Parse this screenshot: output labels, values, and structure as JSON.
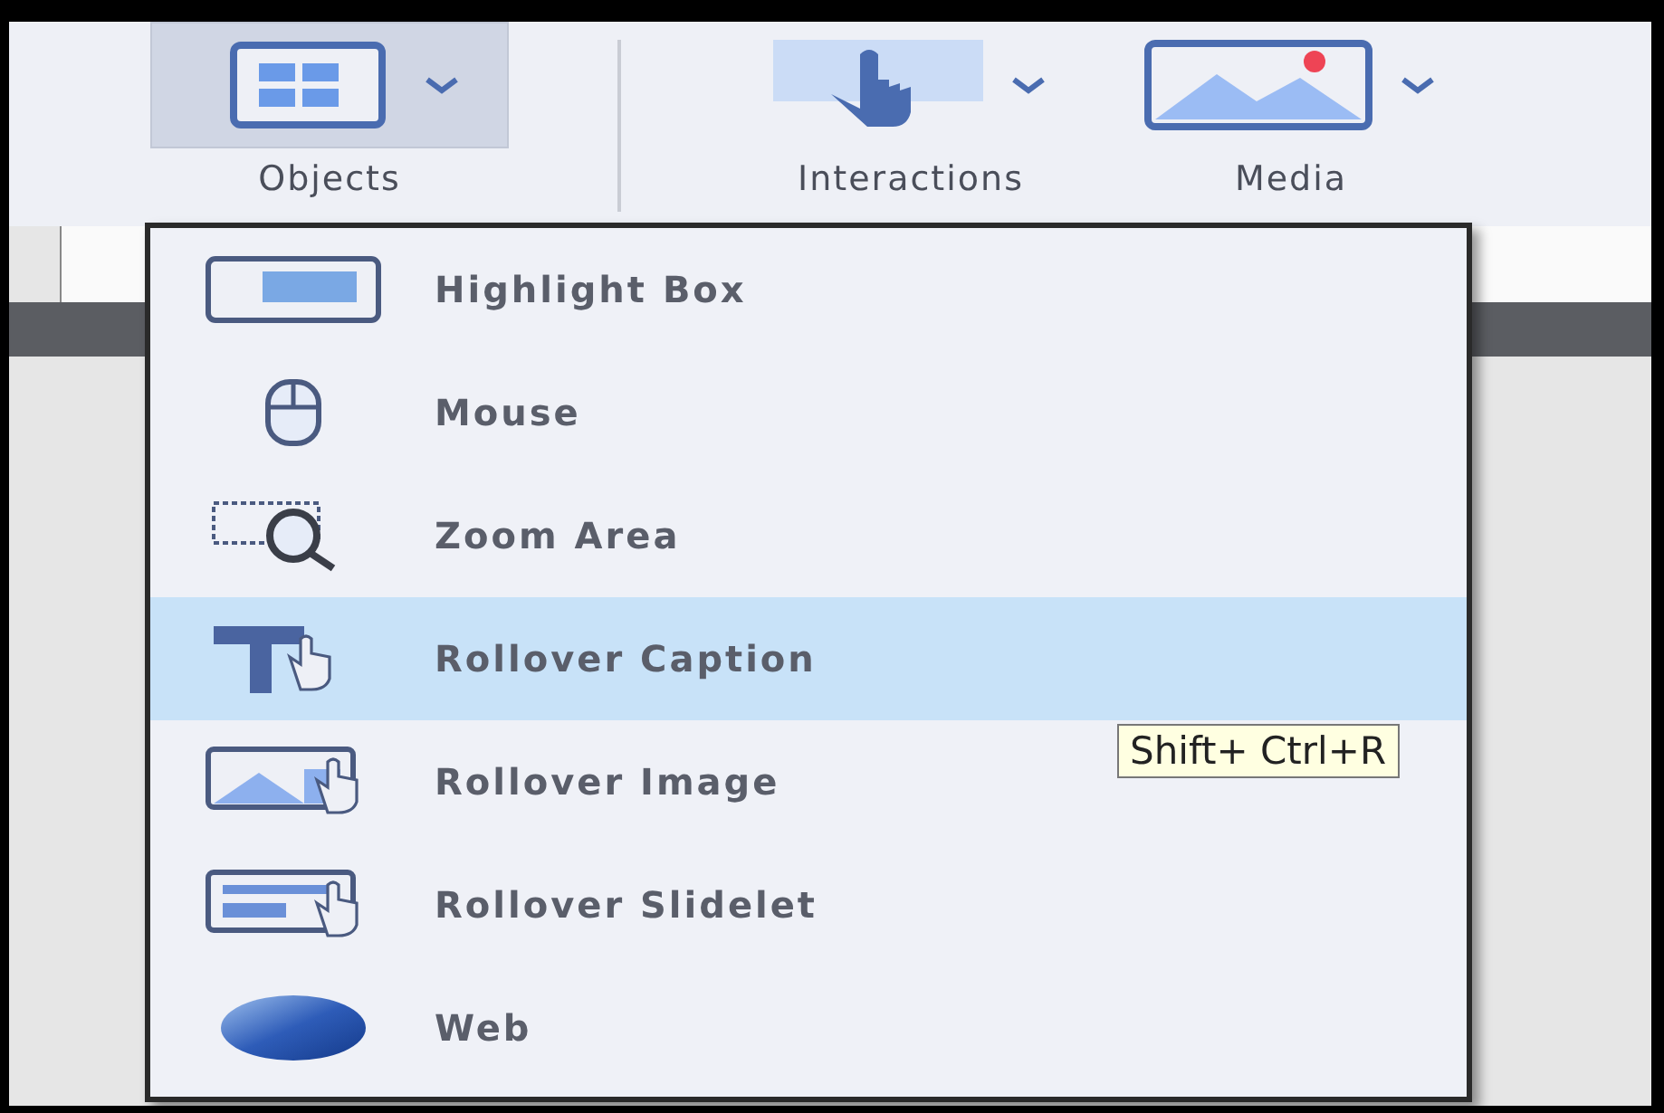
{
  "toolbar": {
    "buttons": [
      {
        "label": "Objects",
        "kind": "objects",
        "selected": true
      },
      {
        "label": "Interactions",
        "kind": "interactions",
        "selected": false
      },
      {
        "label": "Media",
        "kind": "media",
        "selected": false
      }
    ]
  },
  "menu": {
    "items": [
      {
        "label": "Highlight Box",
        "kind": "highlight",
        "selected": false
      },
      {
        "label": "Mouse",
        "kind": "mouse",
        "selected": false
      },
      {
        "label": "Zoom Area",
        "kind": "zoom",
        "selected": false
      },
      {
        "label": "Rollover Caption",
        "kind": "caption",
        "selected": true
      },
      {
        "label": "Rollover Image",
        "kind": "image",
        "selected": false
      },
      {
        "label": "Rollover Slidelet",
        "kind": "slidelet",
        "selected": false
      },
      {
        "label": "Web",
        "kind": "web",
        "selected": false
      }
    ]
  },
  "tooltip": {
    "text": "Shift+ Ctrl+R"
  }
}
